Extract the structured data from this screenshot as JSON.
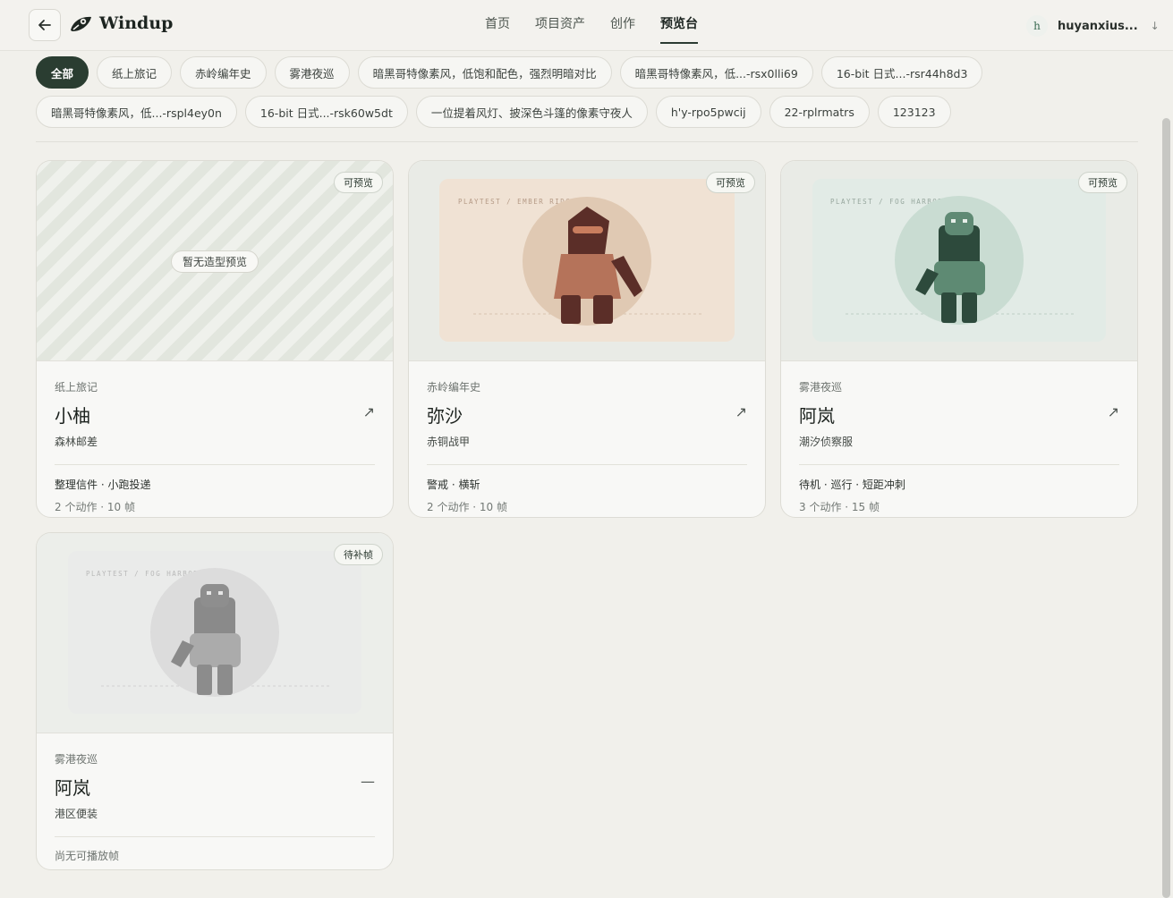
{
  "header": {
    "brand": "Windup",
    "nav": [
      "首页",
      "项目资产",
      "创作",
      "预览台"
    ],
    "active_nav": "预览台",
    "user_initial": "h",
    "username": "huyanxius...",
    "user_caret": "↓"
  },
  "filters": {
    "row1": [
      "全部",
      "纸上旅记",
      "赤岭编年史",
      "雾港夜巡",
      "暗黑哥特像素风，低饱和配色，强烈明暗对比",
      "暗黑哥特像素风，低...-rsx0lli69",
      "16-bit 日式...-rsr44h8d3"
    ],
    "row2": [
      "暗黑哥特像素风，低...-rspl4ey0n",
      "16-bit 日式...-rsk60w5dt",
      "一位提着风灯、披深色斗篷的像素守夜人",
      "h'y-rpo5pwcij",
      "22-rplrmatrs",
      "123123"
    ],
    "active": "全部"
  },
  "cards": [
    {
      "badge": "可预览",
      "no_preview_label": "暂无造型预览",
      "project": "纸上旅记",
      "name": "小柚",
      "outfit": "森林邮差",
      "actions": "整理信件 · 小跑投递",
      "meta": "2 个动作 · 10 帧",
      "open_icon": "↗"
    },
    {
      "badge": "可预览",
      "scene_label": "PLAYTEST / EMBER RIDGE",
      "project": "赤岭编年史",
      "name": "弥沙",
      "outfit": "赤铜战甲",
      "actions": "警戒 · 横斩",
      "meta": "2 个动作 · 10 帧",
      "open_icon": "↗",
      "colors": {
        "bg": "#f0e2d4",
        "circle": "#e0c9b3",
        "head": "#5b2e28",
        "visor": "#c87d5e",
        "body": "#b5735a",
        "arm": "#5b2e28",
        "legs": "#5b2e28"
      }
    },
    {
      "badge": "可预览",
      "scene_label": "PLAYTEST / FOG HARBOR",
      "project": "雾港夜巡",
      "name": "阿岚",
      "outfit": "潮汐侦察服",
      "actions": "待机 · 巡行 · 短距冲刺",
      "meta": "3 个动作 · 15 帧",
      "open_icon": "↗",
      "colors": {
        "bg": "#e2ebe6",
        "circle": "#c9dcd2",
        "head": "#5f8a74",
        "torso": "#2d4a3c",
        "body": "#5e8a73",
        "arm": "#2d4a3c",
        "legs": "#2d4a3c"
      }
    },
    {
      "badge": "待补帧",
      "scene_label": "PLAYTEST / FOG HARBOR",
      "project": "雾港夜巡",
      "name": "阿岚",
      "outfit": "港区便装",
      "empty": "尚无可播放帧",
      "dash_icon": "—",
      "colors": {
        "bg": "#eaebea",
        "circle": "#dcdcdc",
        "head": "#8e8e8e",
        "torso": "#8a8a8a",
        "body": "#ababab",
        "arm": "#8a8a8a",
        "legs": "#8c8c8c"
      }
    }
  ]
}
